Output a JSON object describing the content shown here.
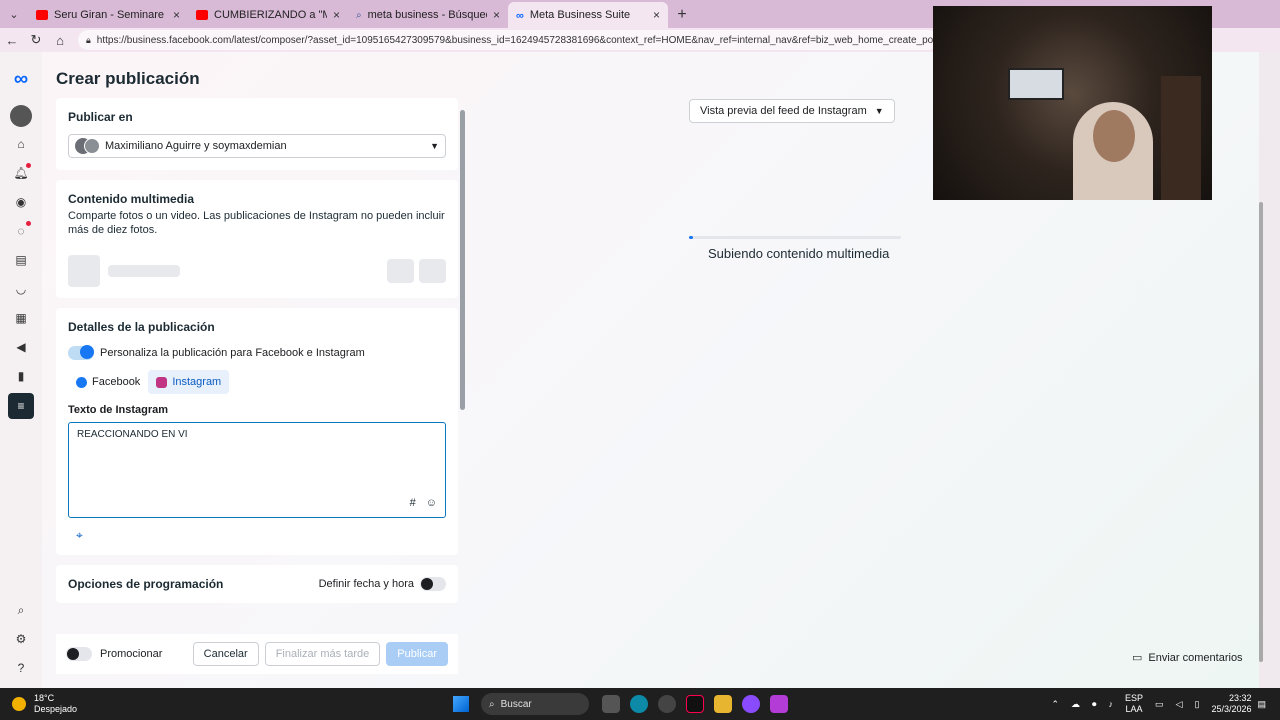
{
  "browser": {
    "tabs": [
      {
        "label": "Seru Giran - Seminare - Karaoke l",
        "color": "#ff0000",
        "active": false
      },
      {
        "label": "CUMBIERIZANDO a \"Maria Becerr",
        "color": "#ff0000",
        "active": false
      },
      {
        "label": "meta business - Búsqueda",
        "color": "#3b5998",
        "active": false
      },
      {
        "label": "Meta Business Suite",
        "color": "#0866ff",
        "active": true
      }
    ],
    "url": "https://business.facebook.com/latest/composer/?asset_id=1095165427309579&business_id=1624945728381696&context_ref=HOME&nav_ref=internal_nav&ref=biz_web_home_create_post"
  },
  "page_title": "Crear publicación",
  "publish_in": {
    "heading": "Publicar en",
    "account": "Maximiliano Aguirre y soymaxdemian"
  },
  "media": {
    "heading": "Contenido multimedia",
    "description": "Comparte fotos o un video. Las publicaciones de Instagram no pueden incluir más de diez fotos."
  },
  "details": {
    "heading": "Detalles de la publicación",
    "customize_label": "Personaliza la publicación para Facebook e Instagram",
    "customize_on": true,
    "tab_facebook": "Facebook",
    "tab_instagram": "Instagram",
    "text_label": "Texto de Instagram",
    "text_value": "REACCIONANDO EN VI",
    "hashtag_symbol": "#",
    "emoji_symbol": "☺",
    "location_symbol": "⌖"
  },
  "scheduling": {
    "heading": "Opciones de programación",
    "set_date_label": "Definir fecha y hora",
    "set_date_on": false
  },
  "footer": {
    "promote_label": "Promocionar",
    "cancel": "Cancelar",
    "finish_later": "Finalizar más tarde",
    "publish": "Publicar"
  },
  "preview": {
    "selector": "Vista previa del feed de Instagram",
    "upload_status": "Subiendo contenido multimedia",
    "upload_progress": 0.02
  },
  "feedback": "Enviar comentarios",
  "taskbar": {
    "temperature": "18°C",
    "weather": "Despejado",
    "search": "Buscar",
    "lang_line1": "ESP",
    "lang_line2": "LAA",
    "time": "23:32",
    "date": "25/3/2026"
  },
  "colors": {
    "accent": "#1877f2",
    "meta_blue": "#0866ff",
    "rail_active": "#1c2b33"
  }
}
